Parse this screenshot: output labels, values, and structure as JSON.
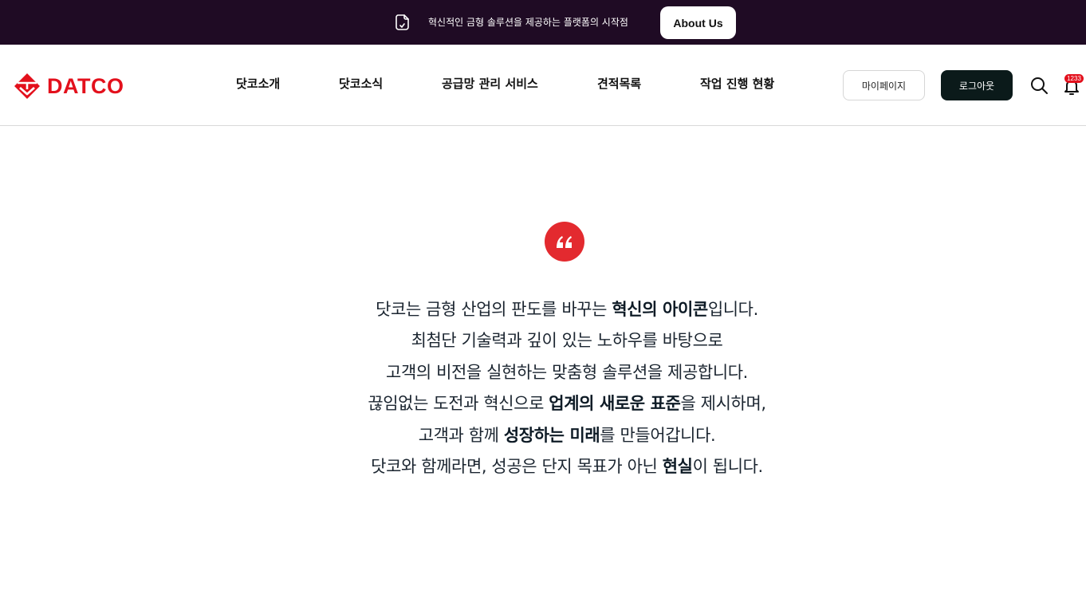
{
  "topbar": {
    "icon": "document-check-icon",
    "message": "혁신적인 금형 솔루션을 제공하는 플랫폼의 시작점",
    "about_label": "About Us"
  },
  "header": {
    "logo_text": "DATCO",
    "logo_icon": "datco-logo-icon",
    "brand_color": "#e3101c",
    "nav": [
      {
        "label": "닷코소개"
      },
      {
        "label": "닷코소식"
      },
      {
        "label": "공급망 관리 서비스"
      },
      {
        "label": "견적목록"
      },
      {
        "label": "작업 진행 현황"
      }
    ],
    "mypage_label": "마이페이지",
    "logout_label": "로그아웃",
    "search_icon": "search-icon",
    "bell_icon": "bell-icon",
    "notification_count": "1233"
  },
  "main": {
    "quote_icon": "quote-icon",
    "accent_color": "#e32a2f",
    "lines": [
      {
        "segments": [
          {
            "t": "닷코는 금형 산업의 판도를 바꾸는 ",
            "b": false
          },
          {
            "t": "혁신의 아이콘",
            "b": true
          },
          {
            "t": "입니다.",
            "b": false
          }
        ]
      },
      {
        "segments": [
          {
            "t": "최첨단 기술력과 깊이 있는 노하우를 바탕으로",
            "b": false
          }
        ]
      },
      {
        "segments": [
          {
            "t": "고객의 비전을 실현하는 맞춤형 솔루션을 제공합니다.",
            "b": false
          }
        ]
      },
      {
        "segments": [
          {
            "t": "끊임없는 도전과 혁신으로 ",
            "b": false
          },
          {
            "t": "업계의 새로운 표준",
            "b": true
          },
          {
            "t": "을 제시하며,",
            "b": false
          }
        ]
      },
      {
        "segments": [
          {
            "t": "고객과 함께 ",
            "b": false
          },
          {
            "t": "성장하는 미래",
            "b": true
          },
          {
            "t": "를 만들어갑니다.",
            "b": false
          }
        ]
      },
      {
        "segments": [
          {
            "t": "닷코와 함께라면, 성공은 단지 목표가 아닌 ",
            "b": false
          },
          {
            "t": "현실",
            "b": true
          },
          {
            "t": "이 됩니다.",
            "b": false
          }
        ]
      }
    ]
  }
}
